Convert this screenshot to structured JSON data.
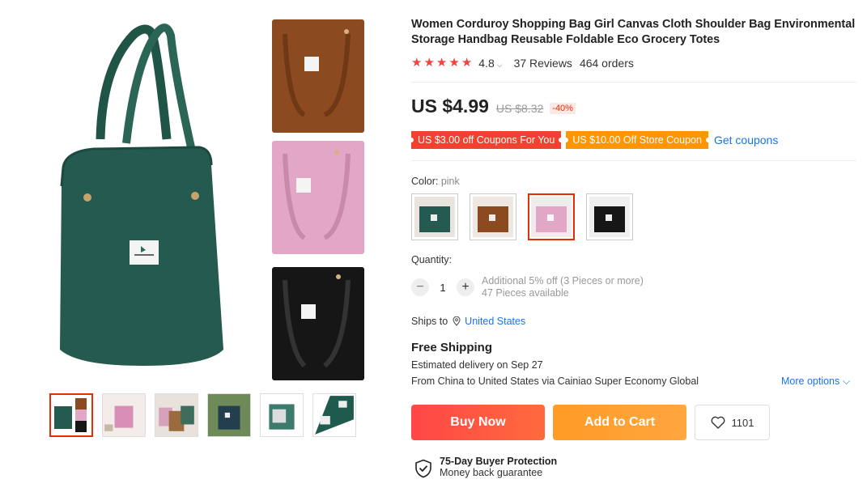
{
  "product": {
    "title": "Women Corduroy Shopping Bag Girl Canvas Cloth Shoulder Bag Environmental Storage Handbag Reusable Foldable Eco Grocery Totes",
    "rating": "4.8",
    "reviews": "37 Reviews",
    "orders": "464 orders",
    "stars_filled": 5
  },
  "price": {
    "current": "US $4.99",
    "original": "US $8.32",
    "discount": "-40%"
  },
  "coupons": {
    "coupon1": "US $3.00 off Coupons For You",
    "coupon2": "US $10.00 Off Store Coupon",
    "get_link": "Get coupons"
  },
  "color": {
    "label": "Color:",
    "selected": "pink",
    "options": [
      "green",
      "brown",
      "pink",
      "black"
    ],
    "swatch_colors": [
      "#245a50",
      "#8b4a1f",
      "#e2a6c6",
      "#161616"
    ]
  },
  "quantity": {
    "label": "Quantity:",
    "minus": "−",
    "value": "1",
    "plus": "+",
    "offer": "Additional 5% off (3 Pieces or more)",
    "available": "47 Pieces available"
  },
  "shipping": {
    "ships_to_label": "Ships to",
    "ships_to_country": "United States",
    "free": "Free Shipping",
    "est_label": "Estimated delivery on ",
    "est_date": "Sep 27",
    "route_from_label": "From ",
    "route_from": "China",
    "route_to_label": " to ",
    "route_to": "United States",
    "route_via": " via Cainiao Super Economy Global",
    "more_options": "More options"
  },
  "actions": {
    "buy_now": "Buy Now",
    "add_to_cart": "Add to Cart",
    "wishlist_count": "1101"
  },
  "protection": {
    "title": "75-Day Buyer Protection",
    "subtitle": "Money back guarantee"
  },
  "colors": {
    "accent": "#e62e04",
    "link": "#1a73e8",
    "star": "#f4423d"
  }
}
